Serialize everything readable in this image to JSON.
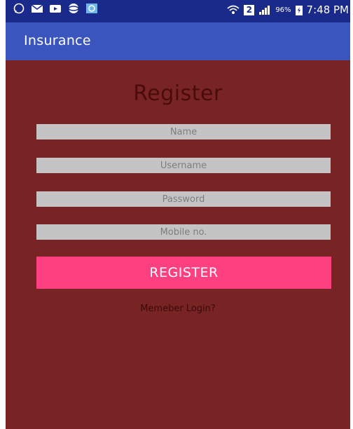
{
  "status_bar": {
    "left_icons": [
      "whatsapp-icon",
      "mail-icon",
      "video-icon",
      "browser-icon",
      "gallery-icon"
    ],
    "sim_badge": "2",
    "battery_percent": "96%",
    "time": "7:48 PM"
  },
  "app_bar": {
    "title": "Insurance"
  },
  "form": {
    "heading": "Register",
    "name_placeholder": "Name",
    "username_placeholder": "Username",
    "password_placeholder": "Password",
    "mobile_placeholder": "Mobile no.",
    "register_label": "REGISTER",
    "login_link": "Memeber Login?"
  },
  "colors": {
    "status_bar": "#1a2a8a",
    "app_bar": "#3a55bd",
    "background": "#792424",
    "field": "#c4c4c4",
    "button": "#ff4080"
  }
}
